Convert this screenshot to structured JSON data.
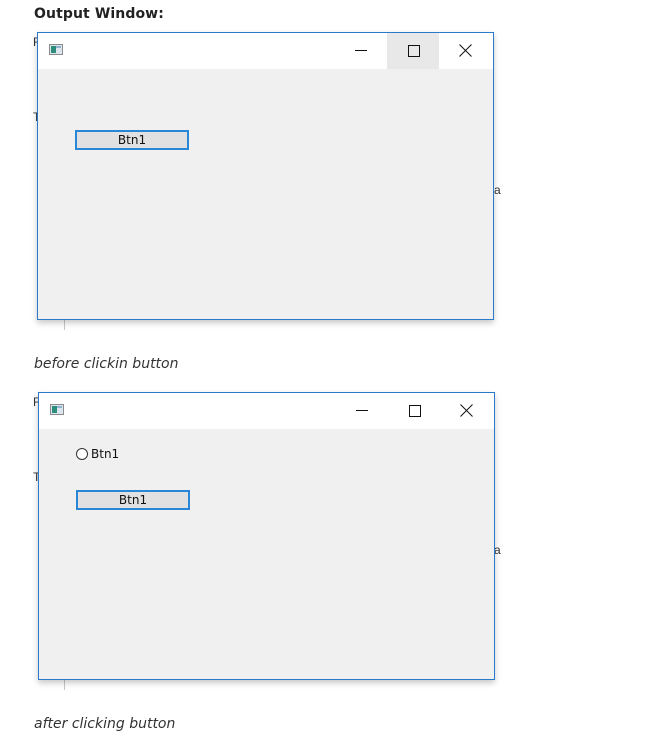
{
  "heading": "Output Window:",
  "screenshots": [
    {
      "caption": "before clickin button",
      "window": {
        "title": "",
        "controls": [
          "minimize",
          "maximize",
          "close"
        ],
        "hovered_control": "maximize",
        "button_label": "Btn1"
      }
    },
    {
      "caption": "after clicking button",
      "window": {
        "title": "",
        "controls": [
          "minimize",
          "maximize",
          "close"
        ],
        "radio_label": "Btn1",
        "button_label": "Btn1"
      }
    }
  ],
  "background_fragments": {
    "left_top": "F",
    "left_mid": "T",
    "right_mid": "a"
  },
  "colors": {
    "window_border": "#2b79c9",
    "client_area": "#f0f0f0",
    "button_focus_border": "#2b86d6",
    "button_face": "#e1e1e1"
  }
}
